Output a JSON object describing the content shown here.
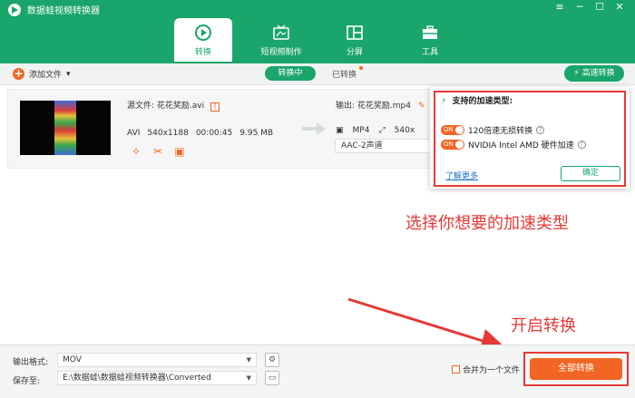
{
  "app": {
    "title": "数据蛙视频转换器",
    "win_menu": "≡",
    "win_min": "─",
    "win_max": "☐",
    "win_close": "✕"
  },
  "nav": {
    "tabs": [
      {
        "label": "转换"
      },
      {
        "label": "短视频制作"
      },
      {
        "label": "分屏"
      },
      {
        "label": "工具"
      }
    ]
  },
  "toolbar": {
    "add_label": "添加文件",
    "converting_label": "转换中",
    "converted_label": "已转换",
    "speed_label": "高速转换"
  },
  "file": {
    "source_label": "源文件: 花花奖励.avi",
    "format": "AVI",
    "resolution": "540x1188",
    "duration": "00:00:45",
    "size": "9.95 MB",
    "output_label": "输出: 花花奖励.mp4",
    "out_format": "MP4",
    "out_resolution": "540x",
    "audio": "AAC-2声道"
  },
  "popup": {
    "title": "支持的加速类型:",
    "toggle_text": "ON",
    "option1": "120倍速无损转换",
    "option2": "NVIDIA   Intel   AMD 硬件加速",
    "learn_more": "了解更多",
    "ok": "确定"
  },
  "annotations": {
    "select_type": "选择你想要的加速类型",
    "start_convert": "开启转换"
  },
  "bottom": {
    "format_label": "输出格式:",
    "format_value": "MOV",
    "save_label": "保存至:",
    "save_value": "E:\\数据蛙\\数据蛙视频转换器\\Converted",
    "merge_label": "合并为一个文件",
    "convert_all": "全部转换"
  },
  "colors": {
    "brand_green": "#1aa56a",
    "accent_orange": "#f26522",
    "annotation_red": "#e53935"
  }
}
